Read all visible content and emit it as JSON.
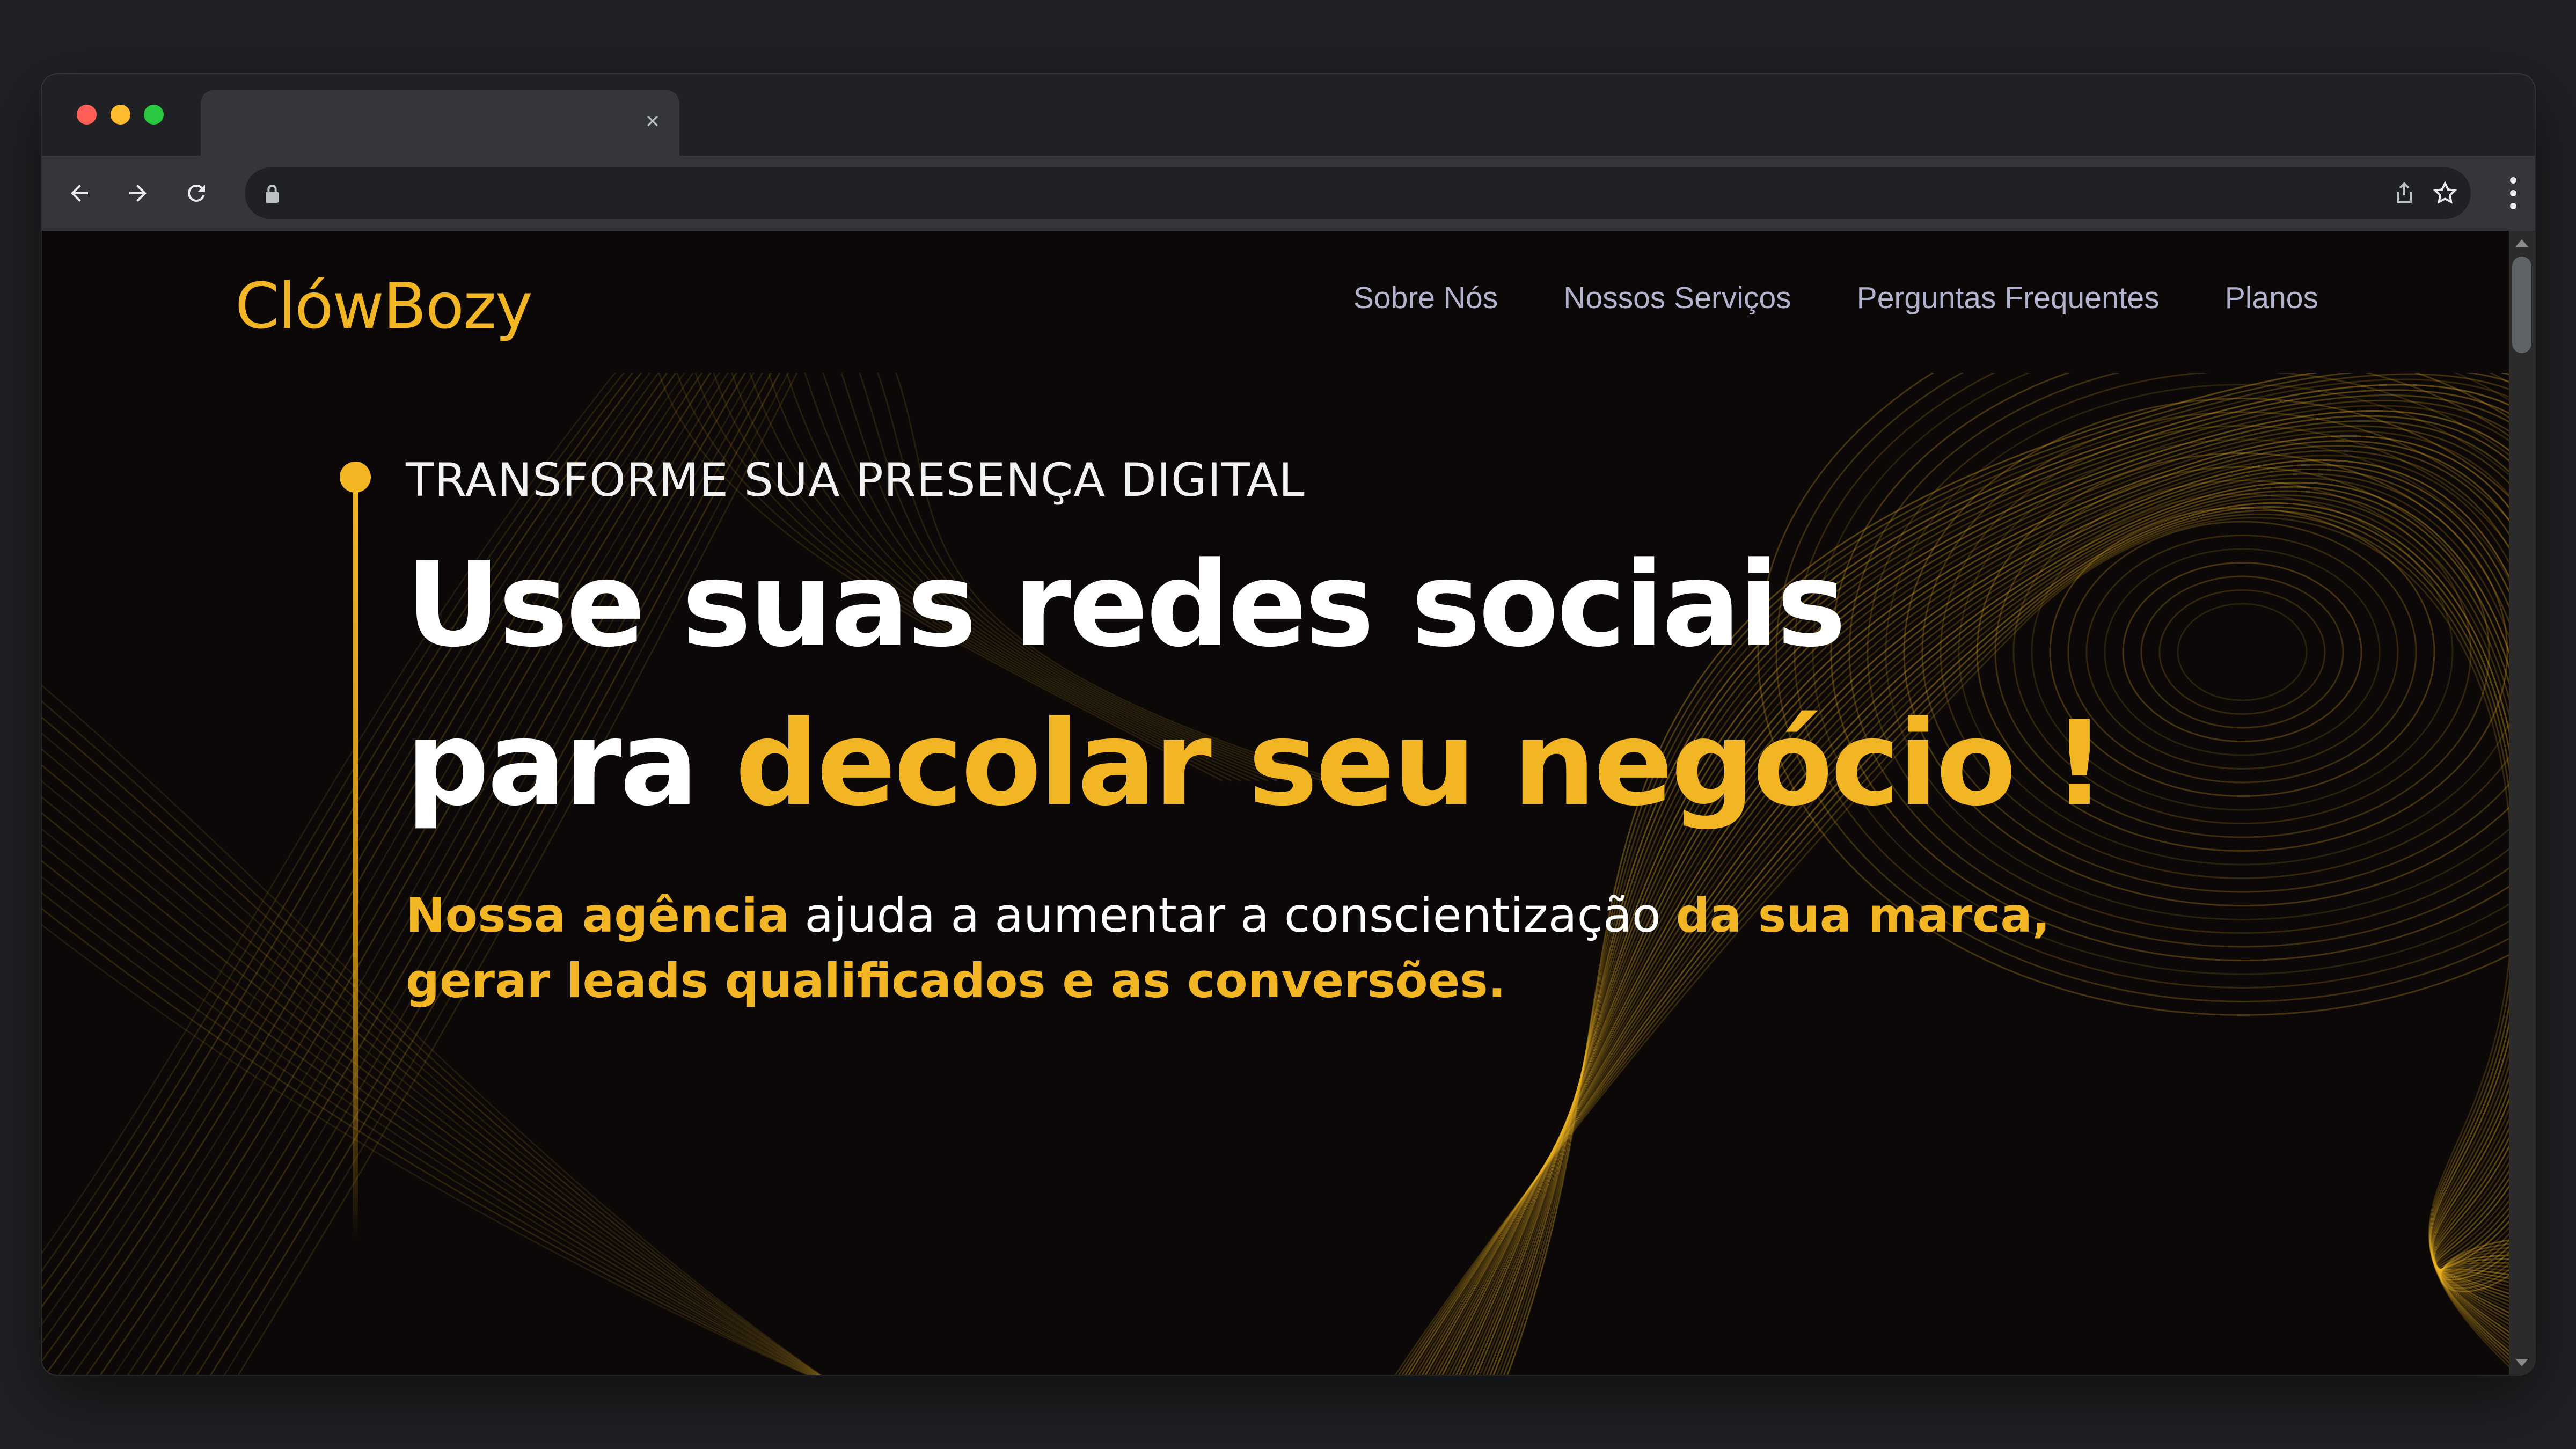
{
  "browser": {
    "tab_close_glyph": "×",
    "url": "",
    "colors": {
      "frame": "#202124",
      "toolbar": "#35363a",
      "close": "#ff5f57",
      "minimize": "#febc2e",
      "maximize": "#28c840"
    }
  },
  "site": {
    "logo_text": "ClówBozy",
    "nav": [
      {
        "label": "Sobre Nós"
      },
      {
        "label": "Nossos Serviços"
      },
      {
        "label": "Perguntas Frequentes"
      },
      {
        "label": "Planos"
      }
    ],
    "colors": {
      "accent": "#f2b624",
      "background": "#0b0807",
      "nav_text": "#b3b3cf"
    }
  },
  "hero": {
    "eyebrow": "TRANSFORME SUA PRESENÇA DIGITAL",
    "headline_line1": "Use suas redes sociais",
    "headline_line2_plain": "para ",
    "headline_line2_accent": "decolar seu negócio !",
    "subtitle_part1_accent": "Nossa agência",
    "subtitle_part2": " ajuda a aumentar a conscientização ",
    "subtitle_part3_accent": "da sua marca, gerar leads qualificados e as conversões."
  }
}
